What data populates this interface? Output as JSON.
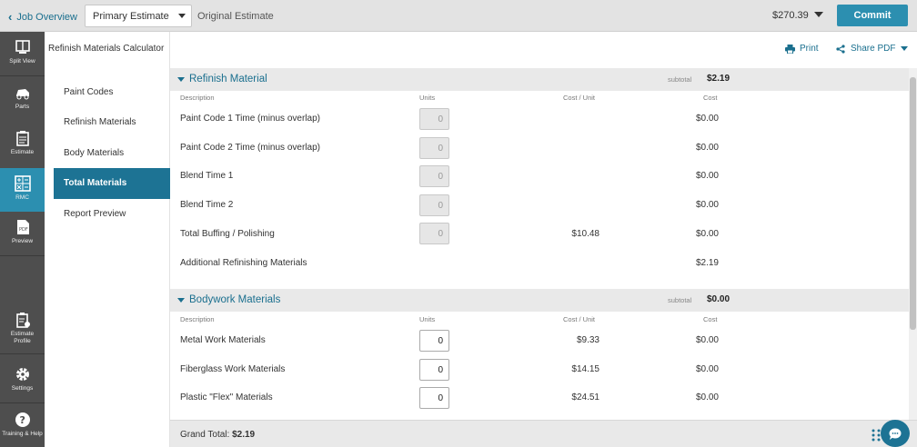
{
  "topbar": {
    "job_overview": "Job Overview",
    "estimate_selected": "Primary Estimate",
    "original_estimate": "Original Estimate",
    "total": "$270.39",
    "commit": "Commit"
  },
  "rail": {
    "items": [
      {
        "label": "Split View",
        "icon": "split-view-icon"
      },
      {
        "label": "Parts",
        "icon": "parts-icon"
      },
      {
        "label": "Estimate",
        "icon": "estimate-icon"
      },
      {
        "label": "RMC",
        "icon": "calculator-icon",
        "active": true
      },
      {
        "label": "Preview",
        "icon": "pdf-icon"
      },
      {
        "label": "Estimate Profile",
        "icon": "profile-icon"
      },
      {
        "label": "Settings",
        "icon": "gear-icon"
      },
      {
        "label": "Training & Help",
        "icon": "help-icon"
      }
    ]
  },
  "subnav": {
    "title": "Refinish Materials Calculator",
    "items": [
      {
        "label": "Paint Codes"
      },
      {
        "label": "Refinish Materials"
      },
      {
        "label": "Body Materials"
      },
      {
        "label": "Total Materials",
        "active": true
      },
      {
        "label": "Report Preview"
      }
    ]
  },
  "actions": {
    "print": "Print",
    "share": "Share PDF"
  },
  "columns": {
    "description": "Description",
    "units": "Units",
    "cost_per_unit": "Cost / Unit",
    "cost": "Cost"
  },
  "refinish": {
    "title": "Refinish Material",
    "subtotal_label": "subtotal",
    "subtotal": "$2.19",
    "rows": [
      {
        "desc": "Paint Code 1 Time (minus overlap)",
        "units": "0",
        "cpu": "",
        "cost": "$0.00",
        "input": "disabled"
      },
      {
        "desc": "Paint Code 2 Time (minus overlap)",
        "units": "0",
        "cpu": "",
        "cost": "$0.00",
        "input": "disabled"
      },
      {
        "desc": "Blend Time 1",
        "units": "0",
        "cpu": "",
        "cost": "$0.00",
        "input": "disabled"
      },
      {
        "desc": "Blend Time 2",
        "units": "0",
        "cpu": "",
        "cost": "$0.00",
        "input": "disabled"
      },
      {
        "desc": "Total Buffing / Polishing",
        "units": "0",
        "cpu": "$10.48",
        "cost": "$0.00",
        "input": "disabled"
      },
      {
        "desc": "Additional Refinishing Materials",
        "units": "",
        "cpu": "",
        "cost": "$2.19",
        "input": "none"
      }
    ]
  },
  "bodywork": {
    "title": "Bodywork Materials",
    "subtotal_label": "subtotal",
    "subtotal": "$0.00",
    "rows": [
      {
        "desc": "Metal Work Materials",
        "units": "0",
        "cpu": "$9.33",
        "cost": "$0.00",
        "input": "enabled"
      },
      {
        "desc": "Fiberglass Work Materials",
        "units": "0",
        "cpu": "$14.15",
        "cost": "$0.00",
        "input": "enabled"
      },
      {
        "desc": "Plastic \"Flex\" Materials",
        "units": "0",
        "cpu": "$24.51",
        "cost": "$0.00",
        "input": "enabled"
      }
    ]
  },
  "footer": {
    "grand_total_label": "Grand Total:",
    "grand_total": "$2.19"
  }
}
